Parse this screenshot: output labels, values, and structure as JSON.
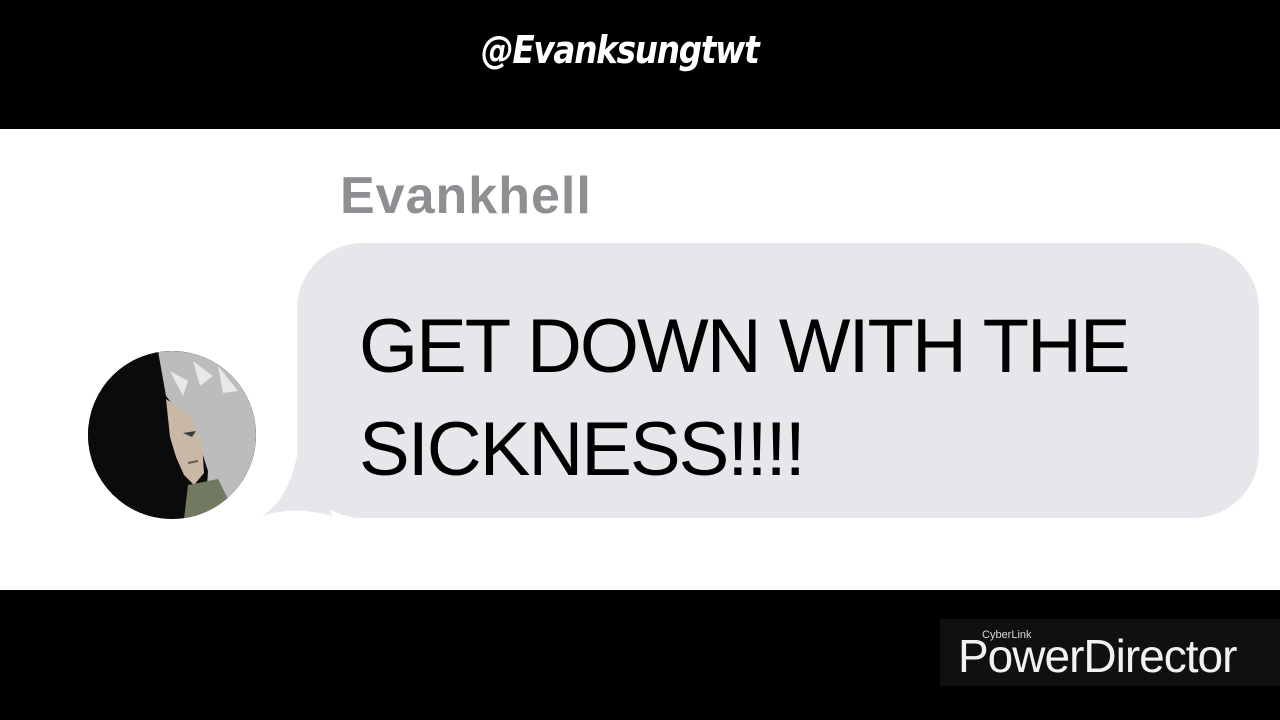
{
  "overlay": {
    "handle": "@Evanksungtwt"
  },
  "message": {
    "sender_name": "Evankhell",
    "text": "GET DOWN WITH THE SICKNESS!!!!",
    "bubble_color": "#e6e6eb",
    "avatar_icon": "anime-character-avatar"
  },
  "watermark": {
    "brand": "CyberLink",
    "product": "PowerDirector"
  }
}
